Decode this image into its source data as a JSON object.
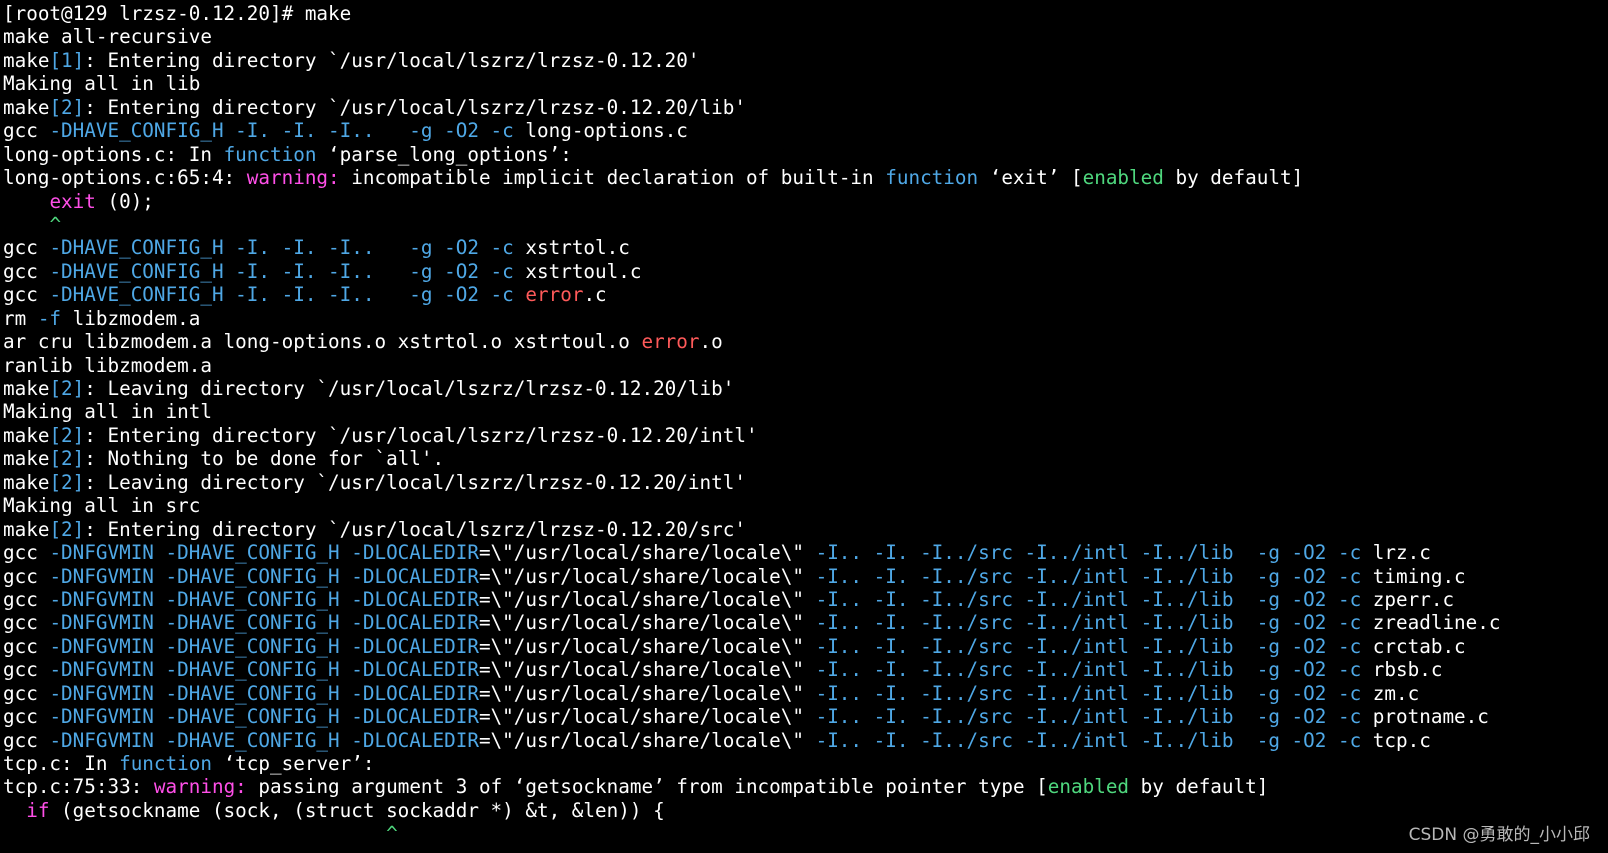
{
  "colors": {
    "default": "#ffffff",
    "cyan": "#4fa8e6",
    "magenta": "#ff4fe8",
    "green": "#4fd87e",
    "red": "#ff5a5a",
    "background": "#000000"
  },
  "lines": [
    [
      {
        "t": "[root@129 lrzsz-0.12.20]# make",
        "c": "default"
      }
    ],
    [
      {
        "t": "make all-recursive",
        "c": "default"
      }
    ],
    [
      {
        "t": "make",
        "c": "default"
      },
      {
        "t": "[1]",
        "c": "cyan"
      },
      {
        "t": ": Entering directory `/usr/local/lszrz/lrzsz-0.12.20'",
        "c": "default"
      }
    ],
    [
      {
        "t": "Making all in lib",
        "c": "default"
      }
    ],
    [
      {
        "t": "make",
        "c": "default"
      },
      {
        "t": "[2]",
        "c": "cyan"
      },
      {
        "t": ": Entering directory `/usr/local/lszrz/lrzsz-0.12.20/lib'",
        "c": "default"
      }
    ],
    [
      {
        "t": "gcc ",
        "c": "default"
      },
      {
        "t": "-DHAVE_CONFIG_H -I. -I. -I..   -g -O2 -c",
        "c": "cyan"
      },
      {
        "t": " long-options.c",
        "c": "default"
      }
    ],
    [
      {
        "t": "long-options.c: In ",
        "c": "default"
      },
      {
        "t": "function",
        "c": "cyan"
      },
      {
        "t": " ‘parse_long_options’:",
        "c": "default"
      }
    ],
    [
      {
        "t": "long-options.c:65:4: ",
        "c": "default"
      },
      {
        "t": "warning:",
        "c": "magenta"
      },
      {
        "t": " incompatible implicit declaration of built-in ",
        "c": "default"
      },
      {
        "t": "function",
        "c": "cyan"
      },
      {
        "t": " ‘exit’ [",
        "c": "default"
      },
      {
        "t": "enabled",
        "c": "green"
      },
      {
        "t": " by default]",
        "c": "default"
      }
    ],
    [
      {
        "t": "    ",
        "c": "default"
      },
      {
        "t": "exit",
        "c": "magenta"
      },
      {
        "t": " (0);",
        "c": "default"
      }
    ],
    [
      {
        "t": "    ",
        "c": "default"
      },
      {
        "t": "^",
        "c": "green"
      }
    ],
    [
      {
        "t": "gcc ",
        "c": "default"
      },
      {
        "t": "-DHAVE_CONFIG_H -I. -I. -I..   -g -O2 -c",
        "c": "cyan"
      },
      {
        "t": " xstrtol.c",
        "c": "default"
      }
    ],
    [
      {
        "t": "gcc ",
        "c": "default"
      },
      {
        "t": "-DHAVE_CONFIG_H -I. -I. -I..   -g -O2 -c",
        "c": "cyan"
      },
      {
        "t": " xstrtoul.c",
        "c": "default"
      }
    ],
    [
      {
        "t": "gcc ",
        "c": "default"
      },
      {
        "t": "-DHAVE_CONFIG_H -I. -I. -I..   -g -O2 -c",
        "c": "cyan"
      },
      {
        "t": " ",
        "c": "default"
      },
      {
        "t": "error",
        "c": "red"
      },
      {
        "t": ".c",
        "c": "default"
      }
    ],
    [
      {
        "t": "rm ",
        "c": "default"
      },
      {
        "t": "-f",
        "c": "cyan"
      },
      {
        "t": " libzmodem.a",
        "c": "default"
      }
    ],
    [
      {
        "t": "ar cru libzmodem.a long-options.o xstrtol.o xstrtoul.o ",
        "c": "default"
      },
      {
        "t": "error",
        "c": "red"
      },
      {
        "t": ".o",
        "c": "default"
      }
    ],
    [
      {
        "t": "ranlib libzmodem.a",
        "c": "default"
      }
    ],
    [
      {
        "t": "make",
        "c": "default"
      },
      {
        "t": "[2]",
        "c": "cyan"
      },
      {
        "t": ": Leaving directory `/usr/local/lszrz/lrzsz-0.12.20/lib'",
        "c": "default"
      }
    ],
    [
      {
        "t": "Making all in intl",
        "c": "default"
      }
    ],
    [
      {
        "t": "make",
        "c": "default"
      },
      {
        "t": "[2]",
        "c": "cyan"
      },
      {
        "t": ": Entering directory `/usr/local/lszrz/lrzsz-0.12.20/intl'",
        "c": "default"
      }
    ],
    [
      {
        "t": "make",
        "c": "default"
      },
      {
        "t": "[2]",
        "c": "cyan"
      },
      {
        "t": ": Nothing to be done for `all'.",
        "c": "default"
      }
    ],
    [
      {
        "t": "make",
        "c": "default"
      },
      {
        "t": "[2]",
        "c": "cyan"
      },
      {
        "t": ": Leaving directory `/usr/local/lszrz/lrzsz-0.12.20/intl'",
        "c": "default"
      }
    ],
    [
      {
        "t": "Making all in src",
        "c": "default"
      }
    ],
    [
      {
        "t": "make",
        "c": "default"
      },
      {
        "t": "[2]",
        "c": "cyan"
      },
      {
        "t": ": Entering directory `/usr/local/lszrz/lrzsz-0.12.20/src'",
        "c": "default"
      }
    ],
    [
      {
        "t": "gcc ",
        "c": "default"
      },
      {
        "t": "-DNFGVMIN -DHAVE_CONFIG_H -DLOCALEDIR",
        "c": "cyan"
      },
      {
        "t": "=\\\"/usr/local/share/locale\\\" ",
        "c": "default"
      },
      {
        "t": "-I.. -I. -I../src -I../intl -I../lib  -g -O2 -c",
        "c": "cyan"
      },
      {
        "t": " lrz.c",
        "c": "default"
      }
    ],
    [
      {
        "t": "gcc ",
        "c": "default"
      },
      {
        "t": "-DNFGVMIN -DHAVE_CONFIG_H -DLOCALEDIR",
        "c": "cyan"
      },
      {
        "t": "=\\\"/usr/local/share/locale\\\" ",
        "c": "default"
      },
      {
        "t": "-I.. -I. -I../src -I../intl -I../lib  -g -O2 -c",
        "c": "cyan"
      },
      {
        "t": " timing.c",
        "c": "default"
      }
    ],
    [
      {
        "t": "gcc ",
        "c": "default"
      },
      {
        "t": "-DNFGVMIN -DHAVE_CONFIG_H -DLOCALEDIR",
        "c": "cyan"
      },
      {
        "t": "=\\\"/usr/local/share/locale\\\" ",
        "c": "default"
      },
      {
        "t": "-I.. -I. -I../src -I../intl -I../lib  -g -O2 -c",
        "c": "cyan"
      },
      {
        "t": " zperr.c",
        "c": "default"
      }
    ],
    [
      {
        "t": "gcc ",
        "c": "default"
      },
      {
        "t": "-DNFGVMIN -DHAVE_CONFIG_H -DLOCALEDIR",
        "c": "cyan"
      },
      {
        "t": "=\\\"/usr/local/share/locale\\\" ",
        "c": "default"
      },
      {
        "t": "-I.. -I. -I../src -I../intl -I../lib  -g -O2 -c",
        "c": "cyan"
      },
      {
        "t": " zreadline.c",
        "c": "default"
      }
    ],
    [
      {
        "t": "gcc ",
        "c": "default"
      },
      {
        "t": "-DNFGVMIN -DHAVE_CONFIG_H -DLOCALEDIR",
        "c": "cyan"
      },
      {
        "t": "=\\\"/usr/local/share/locale\\\" ",
        "c": "default"
      },
      {
        "t": "-I.. -I. -I../src -I../intl -I../lib  -g -O2 -c",
        "c": "cyan"
      },
      {
        "t": " crctab.c",
        "c": "default"
      }
    ],
    [
      {
        "t": "gcc ",
        "c": "default"
      },
      {
        "t": "-DNFGVMIN -DHAVE_CONFIG_H -DLOCALEDIR",
        "c": "cyan"
      },
      {
        "t": "=\\\"/usr/local/share/locale\\\" ",
        "c": "default"
      },
      {
        "t": "-I.. -I. -I../src -I../intl -I../lib  -g -O2 -c",
        "c": "cyan"
      },
      {
        "t": " rbsb.c",
        "c": "default"
      }
    ],
    [
      {
        "t": "gcc ",
        "c": "default"
      },
      {
        "t": "-DNFGVMIN -DHAVE_CONFIG_H -DLOCALEDIR",
        "c": "cyan"
      },
      {
        "t": "=\\\"/usr/local/share/locale\\\" ",
        "c": "default"
      },
      {
        "t": "-I.. -I. -I../src -I../intl -I../lib  -g -O2 -c",
        "c": "cyan"
      },
      {
        "t": " zm.c",
        "c": "default"
      }
    ],
    [
      {
        "t": "gcc ",
        "c": "default"
      },
      {
        "t": "-DNFGVMIN -DHAVE_CONFIG_H -DLOCALEDIR",
        "c": "cyan"
      },
      {
        "t": "=\\\"/usr/local/share/locale\\\" ",
        "c": "default"
      },
      {
        "t": "-I.. -I. -I../src -I../intl -I../lib  -g -O2 -c",
        "c": "cyan"
      },
      {
        "t": " protname.c",
        "c": "default"
      }
    ],
    [
      {
        "t": "gcc ",
        "c": "default"
      },
      {
        "t": "-DNFGVMIN -DHAVE_CONFIG_H -DLOCALEDIR",
        "c": "cyan"
      },
      {
        "t": "=\\\"/usr/local/share/locale\\\" ",
        "c": "default"
      },
      {
        "t": "-I.. -I. -I../src -I../intl -I../lib  -g -O2 -c",
        "c": "cyan"
      },
      {
        "t": " tcp.c",
        "c": "default"
      }
    ],
    [
      {
        "t": "tcp.c: In ",
        "c": "default"
      },
      {
        "t": "function",
        "c": "cyan"
      },
      {
        "t": " ‘tcp_server’:",
        "c": "default"
      }
    ],
    [
      {
        "t": "tcp.c:75:33: ",
        "c": "default"
      },
      {
        "t": "warning:",
        "c": "magenta"
      },
      {
        "t": " passing argument 3 of ‘getsockname’ from incompatible pointer type [",
        "c": "default"
      },
      {
        "t": "enabled",
        "c": "green"
      },
      {
        "t": " by default]",
        "c": "default"
      }
    ],
    [
      {
        "t": "  ",
        "c": "default"
      },
      {
        "t": "if",
        "c": "magenta"
      },
      {
        "t": " (getsockname (sock, (struct sockaddr *) &t, &len)) {",
        "c": "default"
      }
    ],
    [
      {
        "t": "                                 ",
        "c": "default"
      },
      {
        "t": "^",
        "c": "green"
      }
    ]
  ],
  "watermark": "CSDN @勇敢的_小小邱"
}
